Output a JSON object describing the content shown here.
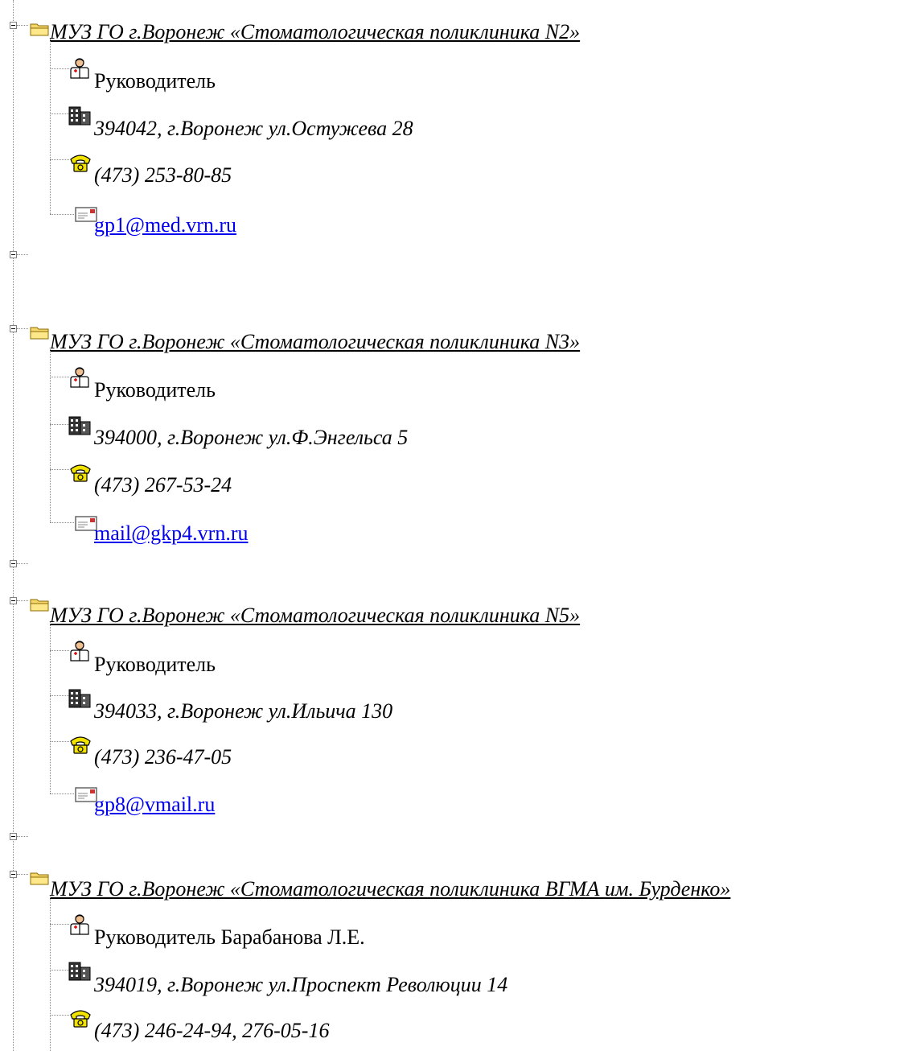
{
  "tree": {
    "groups": [
      {
        "org_name": "МУЗ ГО г.Воронеж «Стоматологическая поликлиника N2»",
        "head": "Руководитель",
        "address": "394042, г.Воронеж ул.Остужева 28",
        "phone": "(473) 253-80-85",
        "email": "gp1@med.vrn.ru"
      },
      {
        "org_name": "МУЗ ГО г.Воронеж «Стоматологическая поликлиника N3»",
        "head": "Руководитель",
        "address": "394000, г.Воронеж ул.Ф.Энгельса 5",
        "phone": "(473) 267-53-24",
        "email": "mail@gkp4.vrn.ru"
      },
      {
        "org_name": "МУЗ ГО г.Воронеж «Стоматологическая  поликлиника N5»",
        "head": "Руководитель",
        "address": "394033, г.Воронеж ул.Ильича 130",
        "phone": "(473) 236-47-05",
        "email": "gp8@vmail.ru"
      },
      {
        "org_name": "МУЗ ГО г.Воронеж «Стоматологическая поликлиника ВГМА им. Бурденко»",
        "head": "Руководитель Барабанова Л.Е.",
        "address": "394019, г.Воронеж ул.Проспект Революции 14",
        "phone": "(473) 246-24-94, 276-05-16"
      }
    ]
  },
  "icons": {
    "toggle": "collapse-toggle-icon",
    "folder": "folder-open-icon",
    "person": "doctor-person-icon",
    "building": "building-icon",
    "phone": "telephone-icon",
    "mail": "envelope-icon"
  },
  "colors": {
    "link": "#0000ee",
    "folder": "#f5d76e",
    "phone": "#f2e200",
    "tree_line": "#8a8a8a"
  }
}
